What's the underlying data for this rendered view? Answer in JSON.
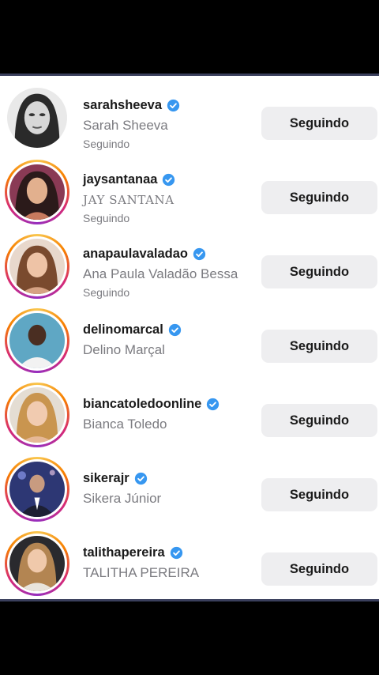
{
  "following_list": [
    {
      "username": "sarahsheeva",
      "full_name": "Sarah Sheeva",
      "status": "Seguindo",
      "button": "Seguindo",
      "story": false,
      "avatar_color": "#cfcfcf"
    },
    {
      "username": "jaysantanaa",
      "full_name": "JAY SANTANA",
      "status": "Seguindo",
      "button": "Seguindo",
      "story": true,
      "avatar_color": "#b45d7a"
    },
    {
      "username": "anapaulavaladao",
      "full_name": "Ana Paula Valadão Bessa",
      "status": "Seguindo",
      "button": "Seguindo",
      "story": true,
      "avatar_color": "#a7745a"
    },
    {
      "username": "delinomarcal",
      "full_name": "Delino Marçal",
      "status": "",
      "button": "Seguindo",
      "story": true,
      "avatar_color": "#4e8aa6"
    },
    {
      "username": "biancatoledoonline",
      "full_name": "Bianca Toledo",
      "status": "",
      "button": "Seguindo",
      "story": true,
      "avatar_color": "#d7b48a"
    },
    {
      "username": "sikerajr",
      "full_name": "Sikera Júnior",
      "status": "",
      "button": "Seguindo",
      "story": true,
      "avatar_color": "#3f4c8c"
    },
    {
      "username": "talithapereira",
      "full_name": "TALITHA PEREIRA",
      "status": "",
      "button": "Seguindo",
      "story": true,
      "avatar_color": "#c9a77a"
    }
  ],
  "colors": {
    "verified": "#3797f0",
    "button_bg": "#eeeef0",
    "secondary_text": "#7b7b80"
  }
}
